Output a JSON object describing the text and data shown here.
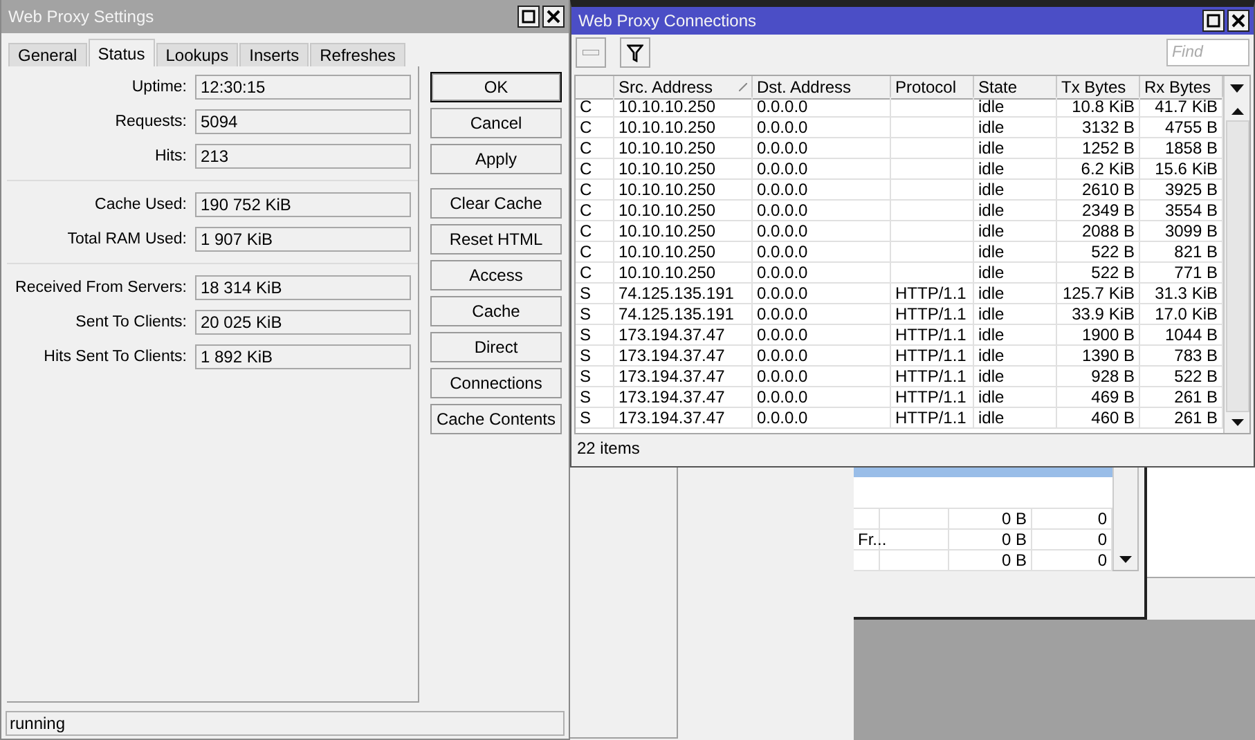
{
  "proxy_settings": {
    "title": "Web Proxy Settings",
    "tabs": [
      {
        "label": "General",
        "selected": false
      },
      {
        "label": "Status",
        "selected": true
      },
      {
        "label": "Lookups",
        "selected": false
      },
      {
        "label": "Inserts",
        "selected": false
      },
      {
        "label": "Refreshes",
        "selected": false
      }
    ],
    "field_groups": [
      [
        {
          "label": "Uptime:",
          "value": "12:30:15"
        },
        {
          "label": "Requests:",
          "value": "5094"
        },
        {
          "label": "Hits:",
          "value": "213"
        }
      ],
      [
        {
          "label": "Cache Used:",
          "value": "190 752 KiB"
        },
        {
          "label": "Total RAM Used:",
          "value": "1 907 KiB"
        }
      ],
      [
        {
          "label": "Received From Servers:",
          "value": "18 314 KiB"
        },
        {
          "label": "Sent To Clients:",
          "value": "20 025 KiB"
        },
        {
          "label": "Hits Sent To Clients:",
          "value": "1 892 KiB"
        }
      ]
    ],
    "buttons": [
      {
        "label": "OK",
        "default": true
      },
      {
        "label": "Cancel",
        "default": false
      },
      {
        "label": "Apply",
        "default": false
      },
      {
        "label": "Clear Cache",
        "default": false
      },
      {
        "label": "Reset HTML",
        "default": false
      },
      {
        "label": "Access",
        "default": false
      },
      {
        "label": "Cache",
        "default": false
      },
      {
        "label": "Direct",
        "default": false
      },
      {
        "label": "Connections",
        "default": false
      },
      {
        "label": "Cache Contents",
        "default": false
      }
    ],
    "status_bar": "running"
  },
  "connections": {
    "title": "Web Proxy Connections",
    "search": {
      "placeholder": "Find"
    },
    "columns": [
      {
        "sorted": false
      },
      {
        "label": "Src. Address",
        "sorted": true
      },
      {
        "label": "Dst. Address",
        "sorted": false
      },
      {
        "label": "Protocol",
        "sorted": false
      },
      {
        "label": "State",
        "sorted": false
      },
      {
        "label": "Tx Bytes",
        "sorted": false
      },
      {
        "label": "Rx Bytes",
        "sorted": false
      }
    ],
    "rows": [
      [
        "C",
        "10.10.10.250",
        "0.0.0.0",
        "",
        "idle",
        "10.8 KiB",
        "41.7 KiB"
      ],
      [
        "C",
        "10.10.10.250",
        "0.0.0.0",
        "",
        "idle",
        "3132 B",
        "4755 B"
      ],
      [
        "C",
        "10.10.10.250",
        "0.0.0.0",
        "",
        "idle",
        "1252 B",
        "1858 B"
      ],
      [
        "C",
        "10.10.10.250",
        "0.0.0.0",
        "",
        "idle",
        "6.2 KiB",
        "15.6 KiB"
      ],
      [
        "C",
        "10.10.10.250",
        "0.0.0.0",
        "",
        "idle",
        "2610 B",
        "3925 B"
      ],
      [
        "C",
        "10.10.10.250",
        "0.0.0.0",
        "",
        "idle",
        "2349 B",
        "3554 B"
      ],
      [
        "C",
        "10.10.10.250",
        "0.0.0.0",
        "",
        "idle",
        "2088 B",
        "3099 B"
      ],
      [
        "C",
        "10.10.10.250",
        "0.0.0.0",
        "",
        "idle",
        "522 B",
        "821 B"
      ],
      [
        "C",
        "10.10.10.250",
        "0.0.0.0",
        "",
        "idle",
        "522 B",
        "771 B"
      ],
      [
        "S",
        "74.125.135.191",
        "0.0.0.0",
        "HTTP/1.1",
        "idle",
        "125.7 KiB",
        "31.3 KiB"
      ],
      [
        "S",
        "74.125.135.191",
        "0.0.0.0",
        "HTTP/1.1",
        "idle",
        "33.9 KiB",
        "17.0 KiB"
      ],
      [
        "S",
        "173.194.37.47",
        "0.0.0.0",
        "HTTP/1.1",
        "idle",
        "1900 B",
        "1044 B"
      ],
      [
        "S",
        "173.194.37.47",
        "0.0.0.0",
        "HTTP/1.1",
        "idle",
        "1390 B",
        "783 B"
      ],
      [
        "S",
        "173.194.37.47",
        "0.0.0.0",
        "HTTP/1.1",
        "idle",
        "928 B",
        "522 B"
      ],
      [
        "S",
        "173.194.37.47",
        "0.0.0.0",
        "HTTP/1.1",
        "idle",
        "469 B",
        "261 B"
      ],
      [
        "S",
        "173.194.37.47",
        "0.0.0.0",
        "HTTP/1.1",
        "idle",
        "460 B",
        "261 B"
      ]
    ],
    "footer": "22 items"
  },
  "background_table": {
    "rows": [
      [
        "",
        "",
        "0 B",
        "0"
      ],
      [
        "Fr...",
        "",
        "0 B",
        "0"
      ],
      [
        "",
        "",
        "0 B",
        "0"
      ]
    ]
  }
}
